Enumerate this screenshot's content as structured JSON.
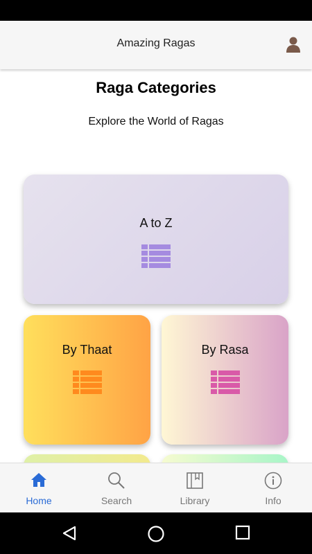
{
  "app_bar": {
    "title": "Amazing Ragas",
    "profile_icon": "user-silhouette-icon"
  },
  "page": {
    "title": "Raga Categories",
    "subtitle": "Explore the World of Ragas"
  },
  "categories": [
    {
      "label": "A to Z",
      "icon": "list-icon",
      "icon_color": "#a58be0"
    },
    {
      "label": "By Thaat",
      "icon": "list-icon",
      "icon_color": "#ff8a1e"
    },
    {
      "label": "By Rasa",
      "icon": "list-icon",
      "icon_color": "#d95aa8"
    }
  ],
  "bottom_nav": {
    "items": [
      {
        "label": "Home",
        "icon": "home-icon",
        "active": true
      },
      {
        "label": "Search",
        "icon": "search-icon",
        "active": false
      },
      {
        "label": "Library",
        "icon": "book-icon",
        "active": false
      },
      {
        "label": "Info",
        "icon": "info-icon",
        "active": false
      }
    ],
    "active_color": "#2a6bd6",
    "inactive_color": "#777777"
  },
  "system_nav": {
    "icons": [
      "back-icon",
      "home-circle-icon",
      "recents-icon"
    ]
  }
}
